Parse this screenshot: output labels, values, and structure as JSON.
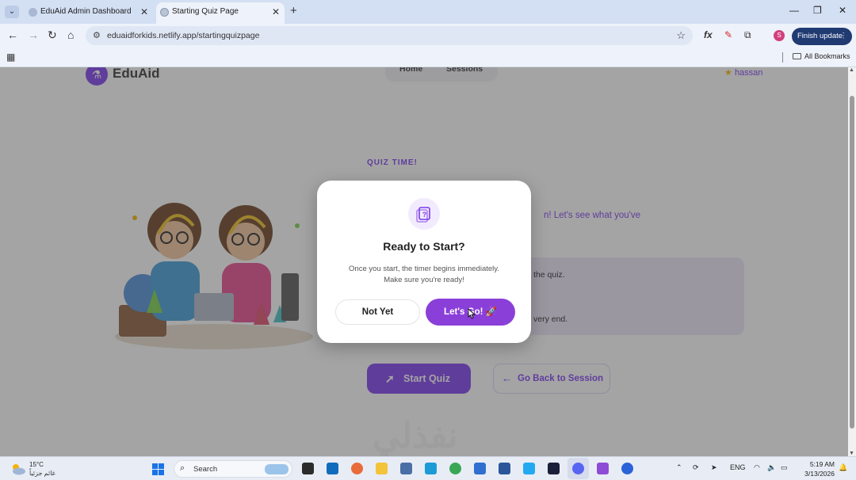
{
  "browser": {
    "tabs": [
      {
        "title": "EduAid Admin Dashboard"
      },
      {
        "title": "Starting Quiz Page"
      }
    ],
    "url": "eduaidforkids.netlify.app/startingquizpage",
    "finish_update_label": "Finish update",
    "profile_initial": "S",
    "all_bookmarks_label": "All Bookmarks"
  },
  "page": {
    "brand": "EduAid",
    "nav": [
      "Home",
      "Sessions"
    ],
    "user_name": "hassan",
    "quiz_label": "QUIZ TIME!",
    "description": "n! Let's see what you've",
    "rules": [
      "the quiz.",
      "very end."
    ],
    "start_label": "Start Quiz",
    "back_label": "Go Back to Session"
  },
  "modal": {
    "title": "Ready to Start?",
    "text_line1": "Once you start, the timer begins immediately.",
    "text_line2": "Make sure you're ready!",
    "not_yet_label": "Not Yet",
    "lets_go_label": "Let's Go! 🚀"
  },
  "watermark": "نفذلي",
  "taskbar": {
    "temperature": "15°C",
    "weather_condition": "غائم جزئياً",
    "search_label": "Search",
    "language": "ENG",
    "time": "5:19 AM",
    "date": "3/13/2026"
  },
  "colors": {
    "accent": "#7c3aed",
    "modal_button": "#8b3fd9",
    "finish_update": "#203a72"
  }
}
